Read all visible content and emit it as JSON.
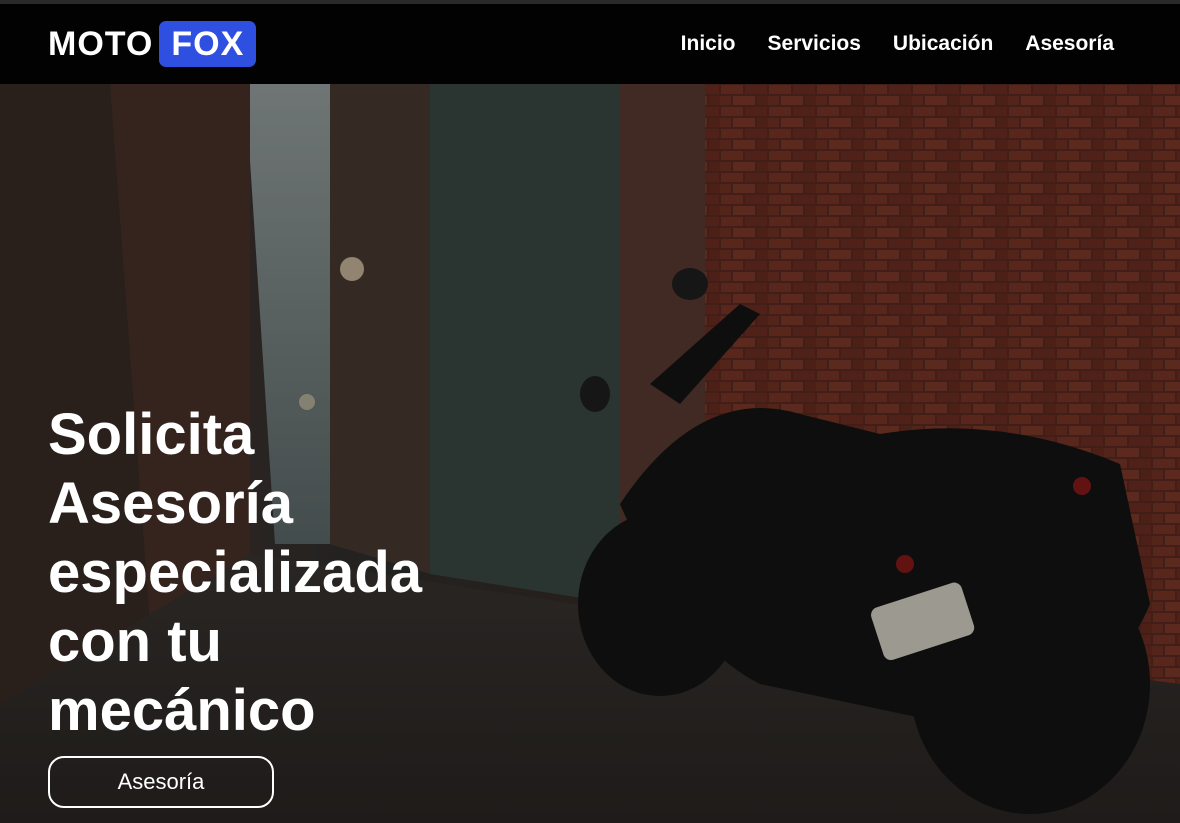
{
  "brand": {
    "part1": "MOTO",
    "part2": "FOX",
    "accent_color": "#2f4fe0"
  },
  "nav": {
    "items": [
      "Inicio",
      "Servicios",
      "Ubicación",
      "Asesoría"
    ]
  },
  "hero": {
    "headline_lines": [
      "Solicita",
      "Asesoría",
      "especializada",
      "con tu",
      "mecánico"
    ],
    "cta_label": "Asesoría",
    "background": "photo of a black motorcycle parked in a brick alley"
  }
}
